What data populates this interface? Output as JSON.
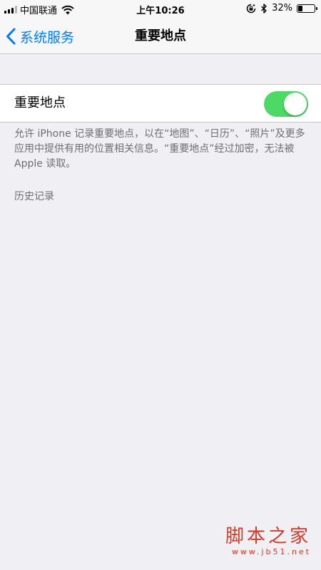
{
  "status_bar": {
    "carrier": "中国联通",
    "time": "上午10:26",
    "battery": "32%",
    "battery_level": 0.32
  },
  "nav": {
    "back_label": "系统服务",
    "title": "重要地点"
  },
  "setting": {
    "label": "重要地点",
    "enabled": true,
    "accent_color": "#4cd964"
  },
  "footer": "允许 iPhone 记录重要地点，以在“地图”、“日历”、“照片”及更多应用中提供有用的位置相关信息。“重要地点”经过加密，无法被 Apple 读取。",
  "history_header": "历史记录",
  "watermark": {
    "main": "脚本之家",
    "url": "www.jb51.net"
  },
  "colors": {
    "link": "#007aff",
    "background": "#efeff4",
    "watermark": "#d23a2a"
  }
}
